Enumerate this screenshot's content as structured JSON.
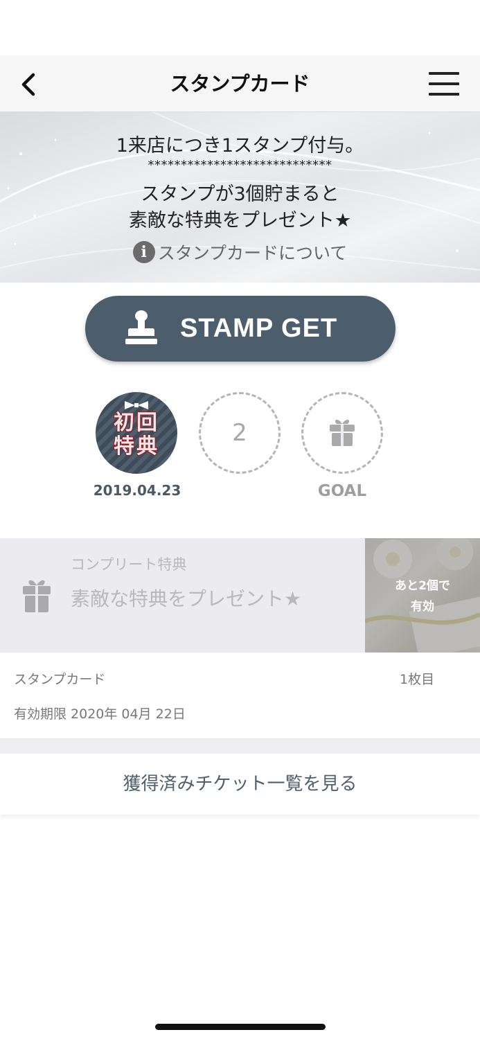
{
  "nav": {
    "title": "スタンプカード",
    "back_icon": "chevron-left-icon",
    "menu_icon": "hamburger-menu-icon"
  },
  "banner": {
    "line1": "1来店につき1スタンプ付与。",
    "stars": "****************************",
    "line2": "スタンプが3個貯まると",
    "line3": "素敵な特典をプレゼント★",
    "about_label": "スタンプカードについて",
    "info_icon_glyph": "i"
  },
  "stamp_button": {
    "label": "STAMP GET",
    "icon": "stamp-icon",
    "color": "#4c5d6b"
  },
  "stamps": {
    "first_text_line1": "初回",
    "first_text_line2": "特典",
    "first_date": "2019.04.23",
    "second_number": "2",
    "goal_label": "GOAL",
    "goal_icon": "gift-icon"
  },
  "reward": {
    "subtitle": "コンプリート特典",
    "title": "素敵な特典をプレゼント★",
    "remaining_line1": "あと2個で",
    "remaining_line2": "有効",
    "icon": "gift-icon"
  },
  "card": {
    "label": "スタンプカード",
    "count": "1枚目",
    "expiry": "有効期限 2020年 04月 22日"
  },
  "ticket_link": {
    "label": "獲得済みチケット一覧を見る"
  }
}
